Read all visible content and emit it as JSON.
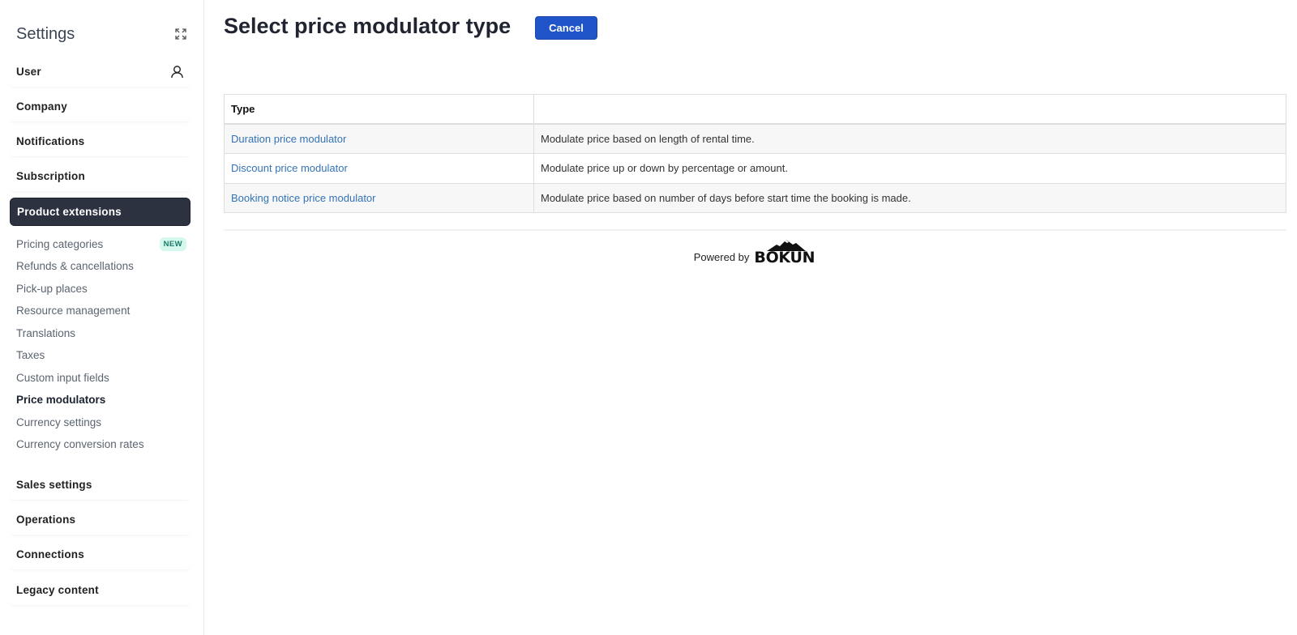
{
  "sidebar": {
    "title": "Settings",
    "sections_top": [
      {
        "label": "User",
        "icon": "user-icon"
      },
      {
        "label": "Company"
      },
      {
        "label": "Notifications"
      },
      {
        "label": "Subscription"
      },
      {
        "label": "Product extensions",
        "active": true
      }
    ],
    "sub_items": [
      {
        "label": "Pricing categories",
        "badge": "NEW"
      },
      {
        "label": "Refunds & cancellations"
      },
      {
        "label": "Pick-up places"
      },
      {
        "label": "Resource management"
      },
      {
        "label": "Translations"
      },
      {
        "label": "Taxes"
      },
      {
        "label": "Custom input fields"
      },
      {
        "label": "Price modulators",
        "active": true
      },
      {
        "label": "Currency settings"
      },
      {
        "label": "Currency conversion rates"
      }
    ],
    "sections_bottom": [
      {
        "label": "Sales settings"
      },
      {
        "label": "Operations"
      },
      {
        "label": "Connections"
      },
      {
        "label": "Legacy content"
      }
    ]
  },
  "main": {
    "title": "Select price modulator type",
    "cancel_label": "Cancel",
    "table": {
      "headers": [
        "Type",
        ""
      ],
      "rows": [
        {
          "type": "Duration price modulator",
          "description": "Modulate price based on length of rental time."
        },
        {
          "type": "Discount price modulator",
          "description": "Modulate price up or down by percentage or amount."
        },
        {
          "type": "Booking notice price modulator",
          "description": "Modulate price based on number of days before start time the booking is made."
        }
      ]
    },
    "footer": {
      "powered_by": "Powered by",
      "brand": "BÓKUN"
    }
  },
  "colors": {
    "active_section_bg": "#2c3240",
    "cancel_button": "#1f55c8",
    "link": "#3473b6",
    "badge_bg": "#d4f7ee",
    "badge_text": "#187a66"
  }
}
